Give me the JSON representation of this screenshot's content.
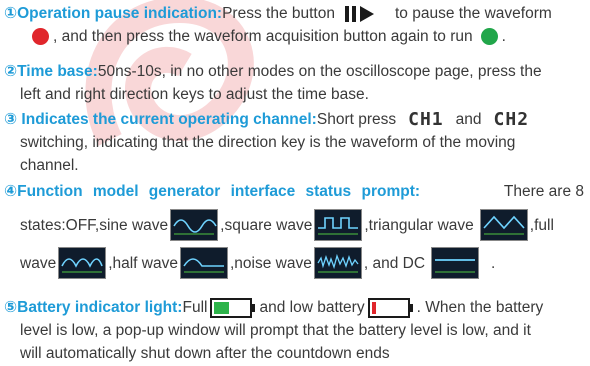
{
  "p1": {
    "heading": "①Operation pause indication:",
    "text_a": "Press the button",
    "text_b": "to pause the waveform",
    "text_c": ", and then press the waveform acquisition button again to run",
    "text_d": ".",
    "colors": {
      "stop": "#e0262c",
      "run": "#21a64a",
      "icon": "#1a1a1a"
    },
    "icon": "pause-play-icon"
  },
  "p2": {
    "heading": "②Time base:",
    "text_a": "50ns-10s, in no other modes on the oscilloscope page, press the",
    "text_b": "left and right direction keys to adjust the time base."
  },
  "p3": {
    "heading": "③ Indicates the current operating channel:",
    "text_a": "Short press",
    "ch1": "CH1",
    "and": "and",
    "ch2": "CH2",
    "text_b": "switching, indicating that the direction key is the waveform of the moving",
    "text_c": "channel."
  },
  "p4": {
    "heading": "④Function model generator interface status prompt:",
    "text_a": "There are 8",
    "line2": {
      "lead": "states:OFF,sine wave",
      "sq": ",square wave",
      "tri": ",triangular wave",
      "full": ",full"
    },
    "line3": {
      "lead": "wave",
      "half": ",half wave",
      "noise": ",noise wave",
      "dc": ", and DC",
      "end": "."
    }
  },
  "p5": {
    "heading": "⑤Battery indicator light:",
    "full": "Full",
    "low": "and low battery",
    "text_a": ". When the battery",
    "text_b": "level is low, a pop-up window will prompt that the battery level is low, and it",
    "text_c": "will automatically shut down after the countdown ends",
    "colors": {
      "full": "#2db34a",
      "low": "#e0262c"
    }
  },
  "accent": "#1e9bd7"
}
